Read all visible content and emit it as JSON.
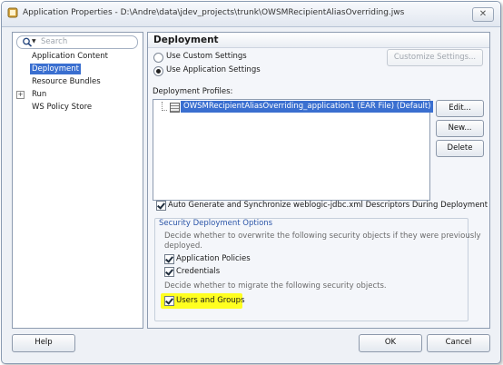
{
  "window": {
    "title": "Application Properties - D:\\Andre\\data\\jdev_projects\\trunk\\OWSMRecipientAliasOverriding.jws",
    "close_label": "✕"
  },
  "search": {
    "placeholder": "Search"
  },
  "nav": {
    "items": [
      {
        "label": "Application Content",
        "selected": false
      },
      {
        "label": "Deployment",
        "selected": true
      },
      {
        "label": "Resource Bundles",
        "selected": false
      },
      {
        "label": "Run",
        "selected": false,
        "expandable": true
      },
      {
        "label": "WS Policy Store",
        "selected": false
      }
    ]
  },
  "panel": {
    "title": "Deployment",
    "radio_custom": {
      "label": "Use Custom Settings",
      "checked": false
    },
    "radio_app": {
      "label": "Use Application Settings",
      "checked": true
    },
    "customize_button": "Customize Settings...",
    "profiles_label": "Deployment Profiles:",
    "profiles": [
      "OWSMRecipientAliasOverriding_application1 (EAR File) (Default)"
    ],
    "edit_button": "Edit...",
    "new_button": "New...",
    "delete_button": "Delete",
    "auto_generate": {
      "label": "Auto Generate and Synchronize weblogic-jdbc.xml Descriptors During Deployment",
      "checked": true
    },
    "security": {
      "title": "Security Deployment Options",
      "overwrite_desc_line1": "Decide whether to overwrite the following security objects if they were previously",
      "overwrite_desc_line2": "deployed.",
      "app_policies": {
        "label": "Application Policies",
        "checked": true
      },
      "credentials": {
        "label": "Credentials",
        "checked": true
      },
      "migrate_desc": "Decide whether to migrate the following security objects.",
      "users_groups": {
        "label": "Users and Groups",
        "checked": true
      }
    }
  },
  "footer": {
    "help_button": "Help",
    "ok_button": "OK",
    "cancel_button": "Cancel"
  },
  "colors": {
    "selection": "#3a6fd0",
    "highlight": "#ffff20",
    "group_title": "#2b55a8"
  }
}
